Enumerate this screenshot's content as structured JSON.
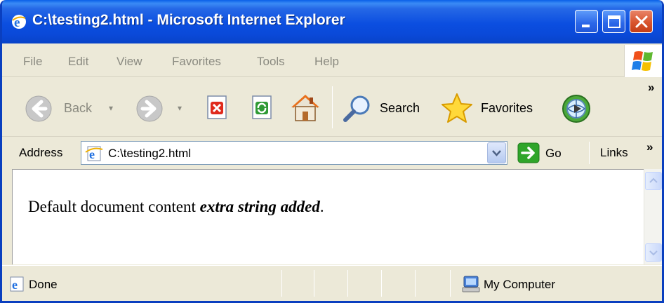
{
  "window": {
    "title": "C:\\testing2.html - Microsoft Internet Explorer"
  },
  "menu": {
    "items": [
      "File",
      "Edit",
      "View",
      "Favorites",
      "Tools",
      "Help"
    ]
  },
  "toolbar": {
    "back_label": "Back",
    "search_label": "Search",
    "favorites_label": "Favorites",
    "overflow": "»"
  },
  "address_bar": {
    "label": "Address",
    "value": "C:\\testing2.html",
    "go_label": "Go",
    "links_label": "Links",
    "links_overflow": "»"
  },
  "document": {
    "text_plain": "Default document content ",
    "text_emphasis": "extra string added",
    "text_tail": "."
  },
  "status_bar": {
    "status": "Done",
    "zone": "My Computer"
  },
  "colors": {
    "titlebar": "#0b4ee0",
    "chrome": "#ece9d8",
    "close_button": "#d9552e",
    "go_arrow": "#2fa52a"
  }
}
